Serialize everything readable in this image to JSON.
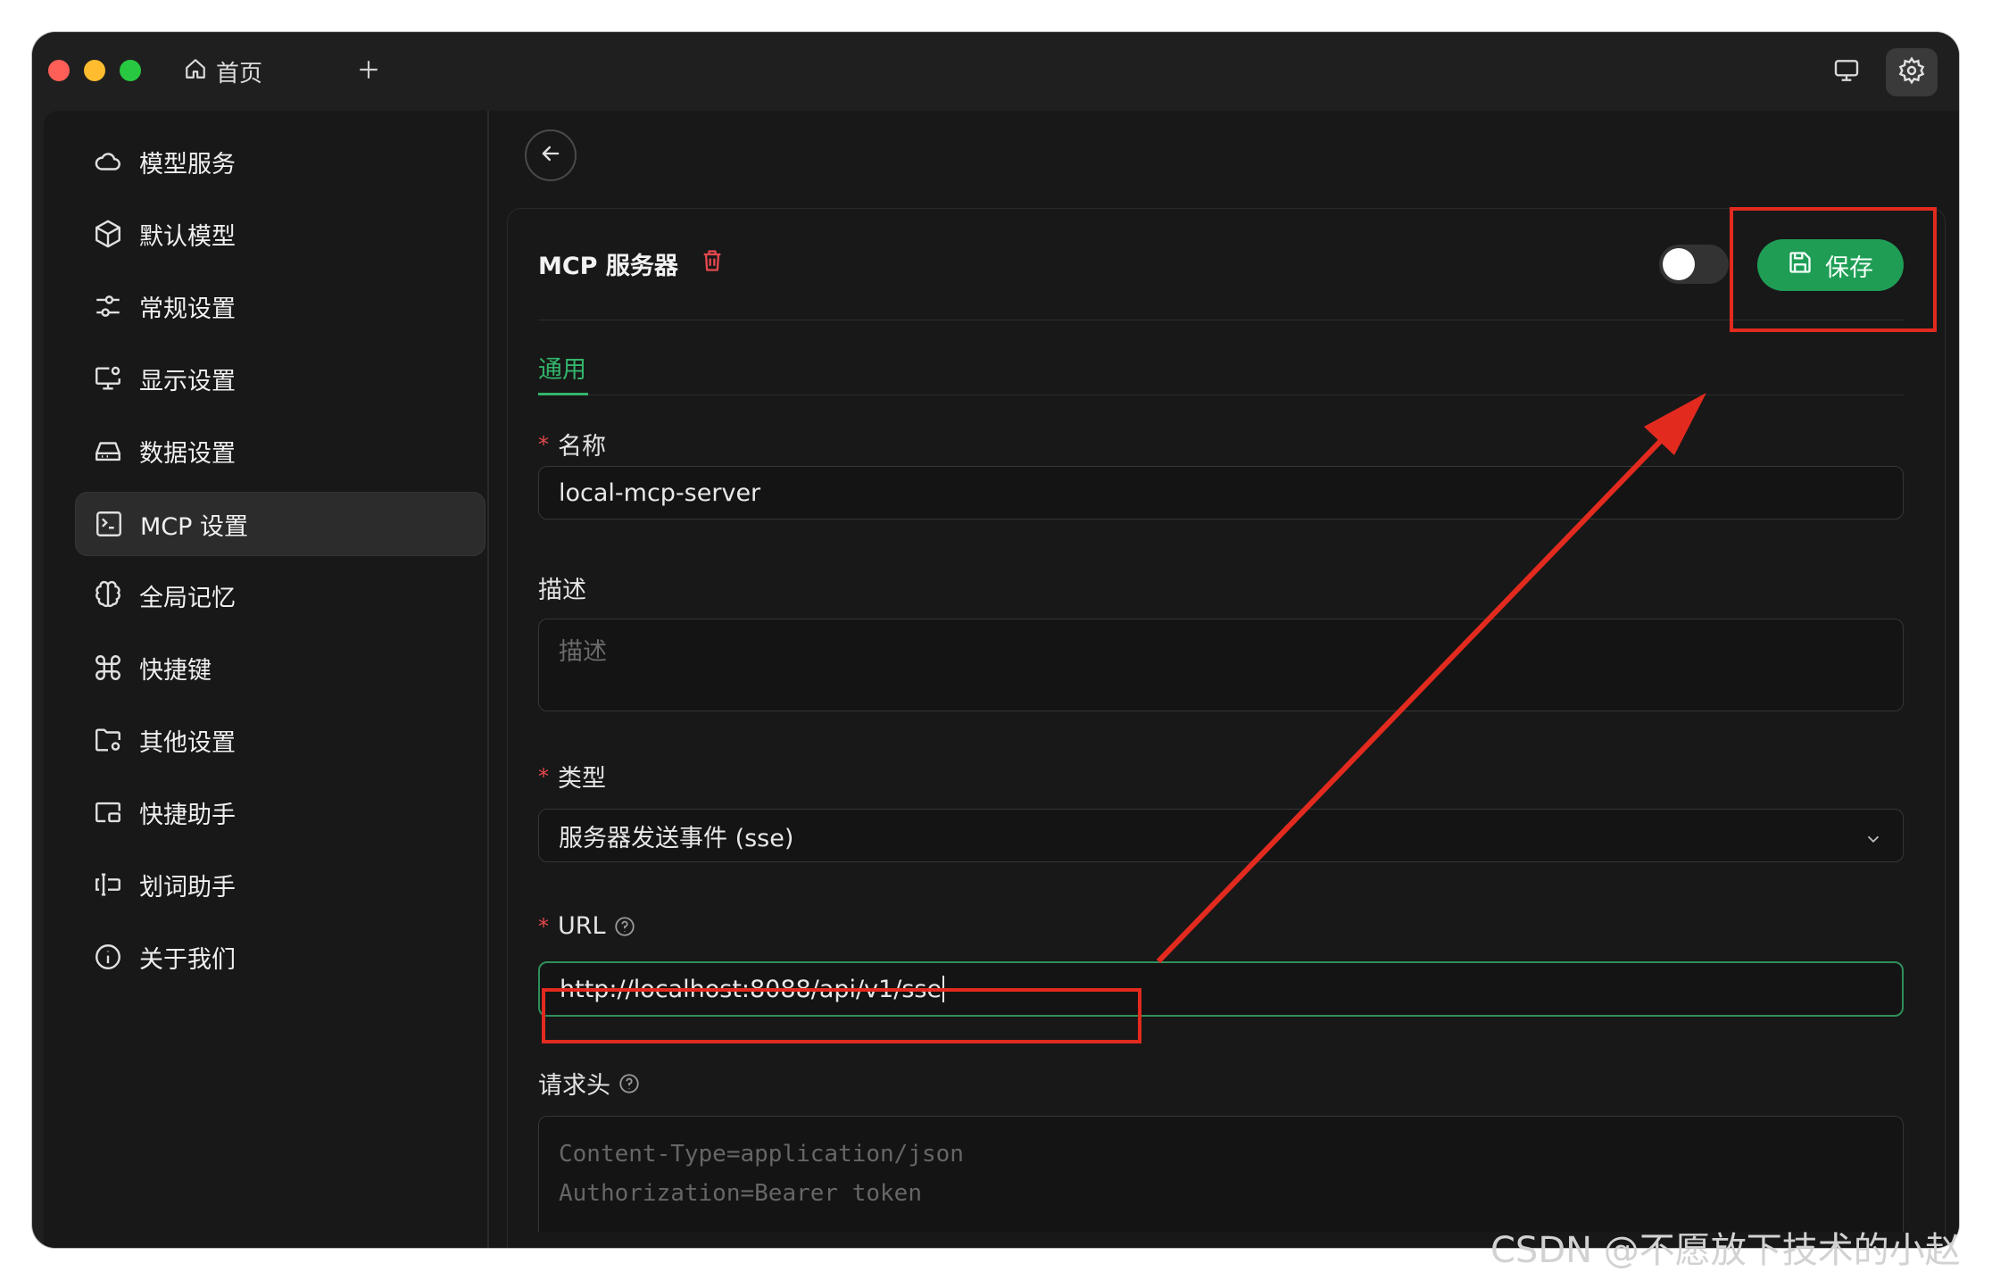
{
  "titlebar": {
    "home_tab": "首页",
    "add_tab_icon": "plus-icon",
    "display_icon": "monitor-icon",
    "settings_icon": "gear-icon"
  },
  "sidebar": {
    "items": [
      {
        "label": "模型服务",
        "icon": "cloud-icon"
      },
      {
        "label": "默认模型",
        "icon": "cube-icon"
      },
      {
        "label": "常规设置",
        "icon": "sliders-icon"
      },
      {
        "label": "显示设置",
        "icon": "monitor-gear-icon"
      },
      {
        "label": "数据设置",
        "icon": "hard-drive-icon"
      },
      {
        "label": "MCP 设置",
        "icon": "terminal-icon",
        "active": true
      },
      {
        "label": "全局记忆",
        "icon": "brain-icon"
      },
      {
        "label": "快捷键",
        "icon": "command-icon"
      },
      {
        "label": "其他设置",
        "icon": "folder-gear-icon"
      },
      {
        "label": "快捷助手",
        "icon": "window-icon"
      },
      {
        "label": "划词助手",
        "icon": "text-cursor-icon"
      },
      {
        "label": "关于我们",
        "icon": "info-icon"
      }
    ]
  },
  "main": {
    "card_title": "MCP 服务器",
    "save_label": "保存",
    "tab_general": "通用",
    "name_label": "名称",
    "name_value": "local-mcp-server",
    "desc_label": "描述",
    "desc_placeholder": "描述",
    "type_label": "类型",
    "type_value": "服务器发送事件 (sse)",
    "url_label": "URL",
    "url_value": "http://localhost:8088/api/v1/sse",
    "headers_label": "请求头",
    "headers_placeholder_line1": "Content-Type=application/json",
    "headers_placeholder_line2": "Authorization=Bearer token"
  },
  "colors": {
    "accent_green": "#1f9d55",
    "annotation_red": "#e22a1f"
  },
  "watermark": "CSDN @不愿放下技术的小赵"
}
